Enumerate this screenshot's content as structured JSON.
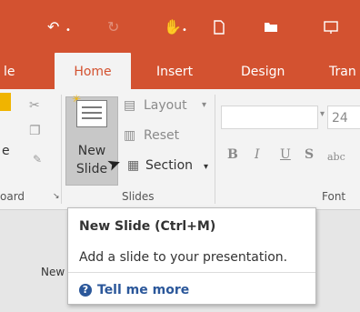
{
  "colors": {
    "accent": "#d35230",
    "ribbon_bg": "#f3f3f3",
    "link": "#2b579a"
  },
  "quick_access": {
    "undo_icon": "undo-arrow",
    "redo_icon": "redo-arrow",
    "touch_icon": "touch-mode",
    "new_icon": "new-document",
    "open_icon": "open-folder",
    "present_icon": "present-from-start"
  },
  "tabs": [
    "le",
    "Home",
    "Insert",
    "Design",
    "Tran"
  ],
  "ribbon": {
    "clipboard_partial_label": "oard",
    "clipboard_partial_text": "e",
    "new_slide_line1": "New",
    "new_slide_line2": "Slide",
    "layout_label": "Layout",
    "reset_label": "Reset",
    "section_label": "Section",
    "slides_group_label": "Slides",
    "font_size_value": "24",
    "bold_label": "B",
    "italic_label": "I",
    "underline_label": "U",
    "strike_label": "S",
    "abc_label": "abc",
    "font_group_label": "Font"
  },
  "tooltip": {
    "title": "New Slide (Ctrl+M)",
    "description": "Add a slide to your presentation.",
    "link_label": "Tell me more",
    "link_icon": "question-icon"
  },
  "slide_area": {
    "partial_text": "New"
  }
}
